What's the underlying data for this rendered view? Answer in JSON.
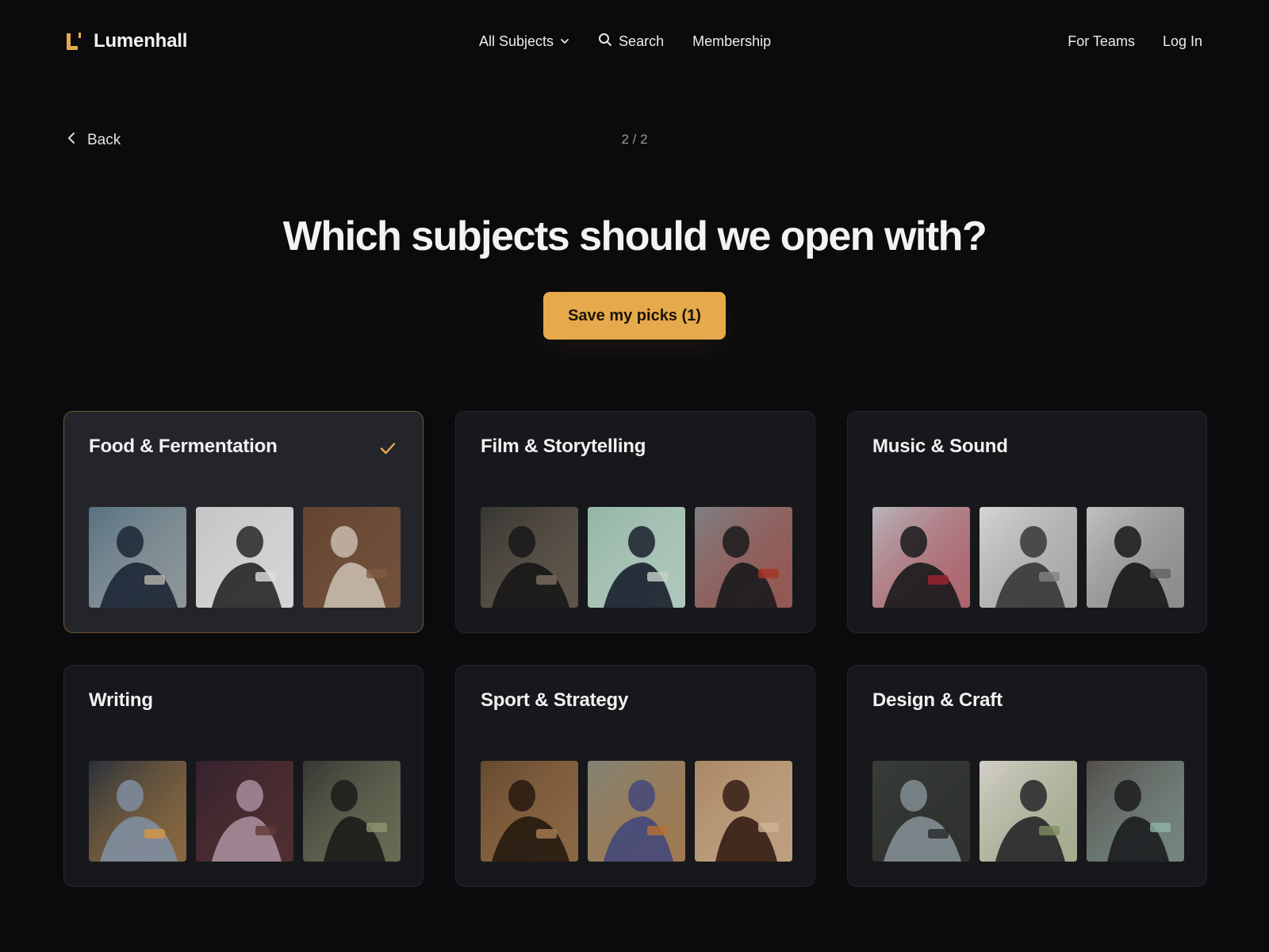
{
  "brand": {
    "name": "Lumenhall",
    "accent": "#e6a94b"
  },
  "nav": {
    "subjects_label": "All Subjects",
    "search_label": "Search",
    "membership_label": "Membership",
    "teams_label": "For Teams",
    "login_label": "Log In"
  },
  "back_label": "Back",
  "pager": "2 / 2",
  "heading": "Which subjects should we open with?",
  "cta_label": "Save my picks (1)",
  "cards": [
    {
      "title": "Food & Fermentation",
      "selected": true,
      "photos": [
        {
          "bg": "#5d7a8c",
          "fg": "#1f2a3a",
          "accent": "#c9c4bc"
        },
        {
          "bg": "#d6d6d6",
          "fg": "#2a2a2a",
          "accent": "#f2f2f2"
        },
        {
          "bg": "#6b4a36",
          "fg": "#d9cdbd",
          "accent": "#8a6248"
        }
      ]
    },
    {
      "title": "Film & Storytelling",
      "selected": false,
      "photos": [
        {
          "bg": "#3c3a36",
          "fg": "#1a1a1a",
          "accent": "#8a7b69"
        },
        {
          "bg": "#9ec6b4",
          "fg": "#1c2330",
          "accent": "#d8e6de"
        },
        {
          "bg": "#8a8c90",
          "fg": "#1d1d1f",
          "accent": "#b43a2c"
        }
      ]
    },
    {
      "title": "Music & Sound",
      "selected": false,
      "photos": [
        {
          "bg": "#c8c6cc",
          "fg": "#1c1c1e",
          "accent": "#b12632"
        },
        {
          "bg": "#e8e8e8",
          "fg": "#3c3c3c",
          "accent": "#8d8d8d"
        },
        {
          "bg": "#d2d2d2",
          "fg": "#1a1a1a",
          "accent": "#6a6a6a"
        }
      ]
    },
    {
      "title": "Writing",
      "selected": false,
      "photos": [
        {
          "bg": "#2b3440",
          "fg": "#8b9aae",
          "accent": "#e8a24a"
        },
        {
          "bg": "#3a2632",
          "fg": "#b59aa8",
          "accent": "#6c3c3a"
        },
        {
          "bg": "#3a3c36",
          "fg": "#1e1e1c",
          "accent": "#9aa27a"
        }
      ]
    },
    {
      "title": "Sport & Strategy",
      "selected": false,
      "photos": [
        {
          "bg": "#6e5034",
          "fg": "#2a1c12",
          "accent": "#b98a5a"
        },
        {
          "bg": "#8d9080",
          "fg": "#4a4f86",
          "accent": "#c67a3a"
        },
        {
          "bg": "#b8936e",
          "fg": "#3a2016",
          "accent": "#e0c3a2"
        }
      ]
    },
    {
      "title": "Design & Craft",
      "selected": false,
      "photos": [
        {
          "bg": "#3e423e",
          "fg": "#8e9aa0",
          "accent": "#2a2c2a"
        },
        {
          "bg": "#e6e2da",
          "fg": "#2a2a2e",
          "accent": "#8a9a6a"
        },
        {
          "bg": "#5a5450",
          "fg": "#1e2022",
          "accent": "#9cc2b8"
        }
      ]
    }
  ]
}
